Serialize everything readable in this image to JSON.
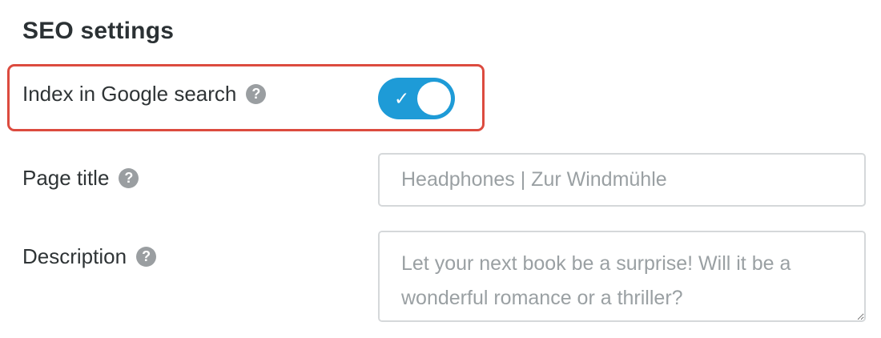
{
  "section": {
    "title": "SEO settings"
  },
  "seo_settings": {
    "index_google": {
      "label": "Index in Google search",
      "help_icon": "question-mark-circle-icon",
      "help_glyph": "?",
      "toggle_checked": true,
      "toggle_glyph": "✓",
      "toggle_icon": "checkmark-icon"
    },
    "page_title": {
      "label": "Page title",
      "help_icon": "question-mark-circle-icon",
      "help_glyph": "?",
      "value": "",
      "placeholder": "Headphones | Zur Windmühle"
    },
    "description": {
      "label": "Description",
      "help_icon": "question-mark-circle-icon",
      "help_glyph": "?",
      "value": "",
      "placeholder": "Let your next book be a surprise! Will it be a wonderful romance or a thriller?"
    }
  },
  "colors": {
    "accent": "#1e9bd7",
    "highlight": "#dc4b3f",
    "help_icon": "#9a9ea1",
    "text": "#2f3436",
    "placeholder": "#9aa0a3",
    "input_border": "#d5d8da"
  }
}
